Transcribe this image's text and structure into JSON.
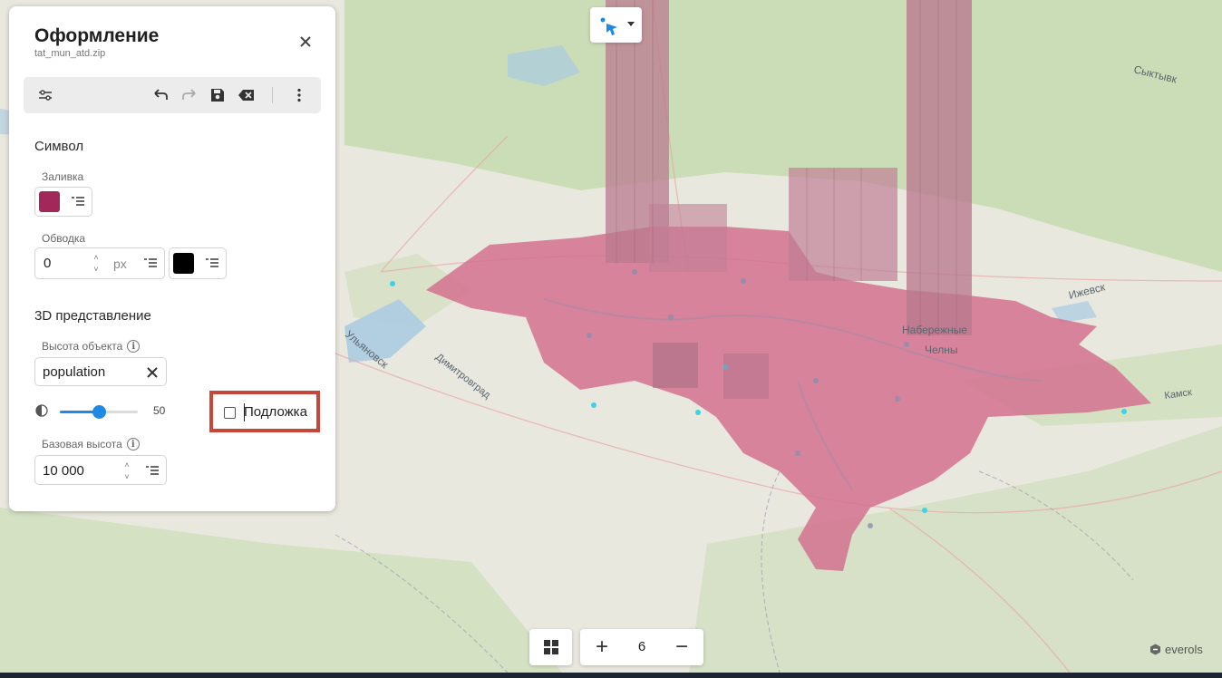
{
  "panel": {
    "title": "Оформление",
    "subtitle": "tat_mun_atd.zip",
    "close_icon": "close-icon",
    "toolbar": {
      "icons": [
        "sliders-icon",
        "undo-icon",
        "redo-icon",
        "save-icon",
        "clear-icon",
        "more-vertical-icon"
      ]
    },
    "symbol": {
      "title": "Символ",
      "fill_label": "Заливка",
      "fill_color": "#a3285a",
      "stroke_label": "Обводка",
      "stroke_width": "0",
      "stroke_unit": "px",
      "stroke_color": "#000000"
    },
    "view3d": {
      "title": "3D представление",
      "height_label": "Высота объекта",
      "height_value": "population",
      "opacity_value": "50",
      "opacity_fraction": 0.5,
      "base_label": "Базовая высота",
      "base_value": "10 000",
      "underlay_label": "Подложка",
      "underlay_checked": false
    }
  },
  "map": {
    "labels": {
      "izhevsk": "Ижевск",
      "ulyanovsk": "Ульяновск",
      "dimitrovgrad": "Димитровград",
      "naberezhnye": "Набережные",
      "chelny": "Челны",
      "syktyvkar": "Сыктывк",
      "kamsk": "Камск"
    },
    "colors": {
      "terrain": "#e8e8df",
      "forest": "#c9ddb4",
      "water": "#a9cbe4",
      "region_fill": "#d3718f",
      "extrusion": "#b97a90"
    }
  },
  "controls": {
    "zoom_level": "6",
    "zoom_in": "+",
    "zoom_out": "−",
    "brand": "everols"
  }
}
